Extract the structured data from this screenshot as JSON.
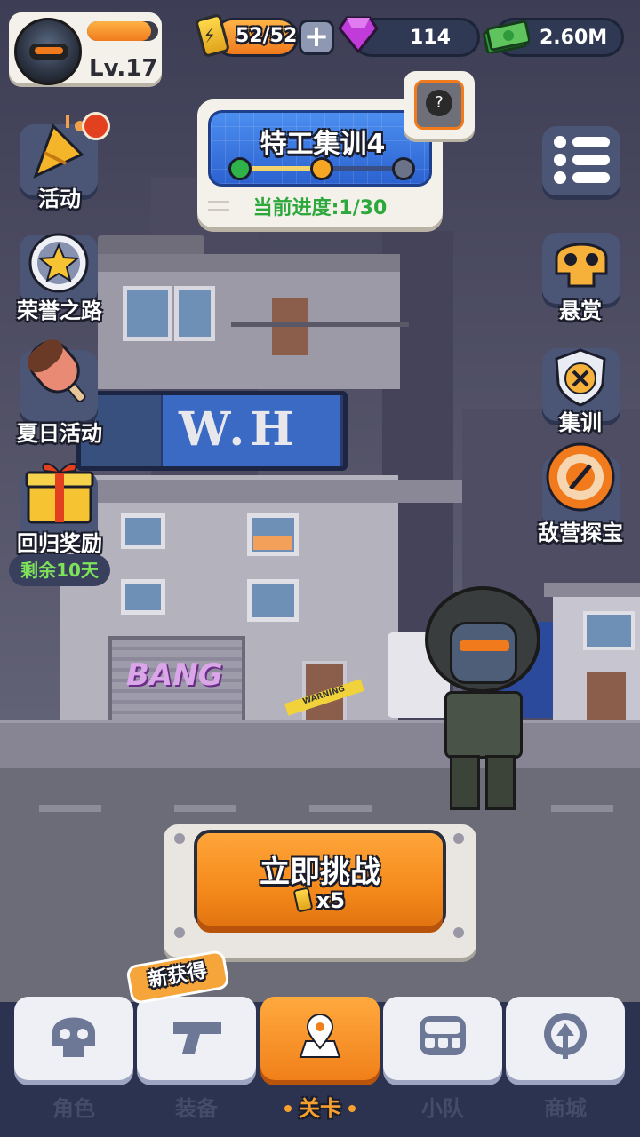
{
  "player": {
    "level": "Lv.17",
    "xp_fraction": 0.9
  },
  "resources": {
    "energy": "52/52",
    "gems": "114",
    "cash": "2.60M"
  },
  "mission": {
    "title": "特工集训4",
    "progress": "当前进度:1/30",
    "reward_icon": "?"
  },
  "left_menu": [
    {
      "label": "活动",
      "icon": "party-popper-icon"
    },
    {
      "label": "荣誉之路",
      "icon": "star-medal-icon"
    },
    {
      "label": "夏日活动",
      "icon": "ice-cream-icon"
    },
    {
      "label": "回归奖励",
      "icon": "gift-box-icon",
      "badge": "剩余10天"
    }
  ],
  "right_menu": [
    {
      "label": "悬赏",
      "icon": "skull-icon"
    },
    {
      "label": "集训",
      "icon": "shield-badge-icon"
    },
    {
      "label": "敌营探宝",
      "icon": "target-treasure-icon"
    }
  ],
  "scene": {
    "billboard": "W.H",
    "graffiti": "BANG",
    "tape": "WARNING"
  },
  "challenge": {
    "label": "立即挑战",
    "cost": "x5"
  },
  "nav": {
    "new_badge": "新获得",
    "items": [
      {
        "label": "角色",
        "icon": "skull-icon"
      },
      {
        "label": "装备",
        "icon": "gun-icon"
      },
      {
        "label": "关卡",
        "icon": "map-pin-icon",
        "active": true
      },
      {
        "label": "小队",
        "icon": "squad-icon"
      },
      {
        "label": "商城",
        "icon": "shop-icon"
      }
    ]
  },
  "colors": {
    "accent": "#f58a1c",
    "panel": "#f4f1ea",
    "mission_blue": "#2b62d0",
    "progress_green": "#2da83c",
    "nav_bg": "#2b3350"
  }
}
